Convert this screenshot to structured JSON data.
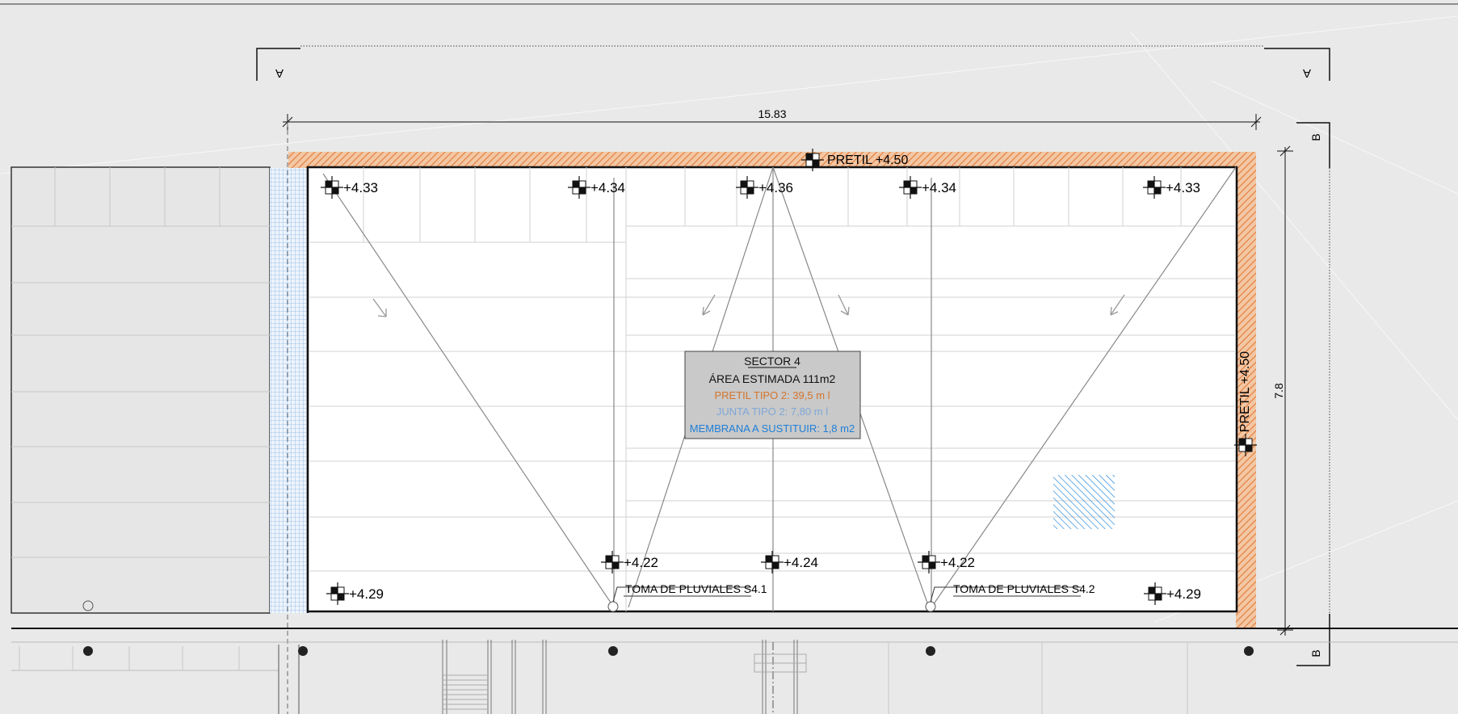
{
  "section_marks": {
    "a_left": "A",
    "a_right": "A",
    "b_top": "B",
    "b_bottom": "B"
  },
  "dimensions": {
    "width": "15.83",
    "height": "7.8"
  },
  "parapet": {
    "top_label": "PRETIL +4.50",
    "right_label": "PRETIL +4.50"
  },
  "levels": {
    "top": [
      "+4.33",
      "+4.34",
      "+4.36",
      "+4.34",
      "+4.33"
    ],
    "bottom": [
      "+4.29",
      "+4.22",
      "+4.24",
      "+4.22",
      "+4.29"
    ]
  },
  "drains": {
    "s41": "TOMA DE PLUVIALES S4.1",
    "s42": "TOMA DE PLUVIALES S4.2"
  },
  "info_box": {
    "sector": "SECTOR 4",
    "area": "ÁREA ESTIMADA 111m2",
    "pretil": "PRETIL TIPO 2: 39,5 m l",
    "junta": "JUNTA TIPO 2: 7,80 m l",
    "membrana": "MEMBRANA A SUSTITUIR: 1,8 m2"
  },
  "colors": {
    "background": "#e9e9e9",
    "roof": "#ffffff",
    "parapet": "#e07b3a",
    "joint": "#6aa0e0",
    "membrane": "#2a8ad8",
    "info_bg": "#c9c9c9",
    "info_pretil": "#d4742c",
    "info_junta": "#7fa8d8",
    "info_membrana": "#1e7fd8"
  }
}
